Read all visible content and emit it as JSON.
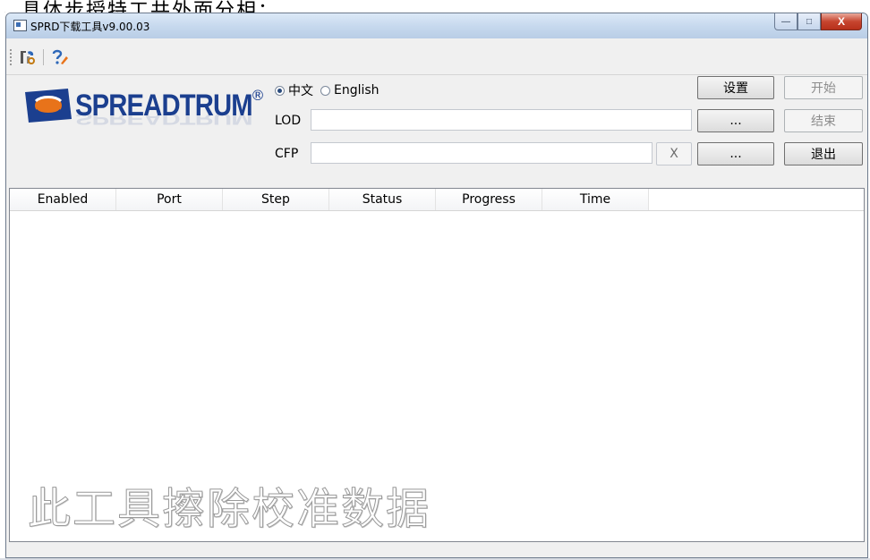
{
  "page_caption": "，具体步授特工共外面分相：",
  "window": {
    "title": "SPRD下载工具v9.00.03",
    "controls": {
      "minimize": "—",
      "maximize": "□",
      "close": "X"
    }
  },
  "toolbar": {
    "icons": [
      "settings-tools-icon",
      "help-icon"
    ]
  },
  "logo": {
    "brand": "SPREADTRUM",
    "registered": "®"
  },
  "language": {
    "selected": "中文",
    "options": [
      "中文",
      "English"
    ]
  },
  "fields": {
    "lod": {
      "label": "LOD",
      "value": ""
    },
    "cfp": {
      "label": "CFP",
      "value": ""
    }
  },
  "buttons": {
    "settings": "设置",
    "start": "开始",
    "stop": "结束",
    "exit": "退出",
    "browse_lod": "...",
    "browse_cfp": "...",
    "clear_cfp": "X"
  },
  "button_state": {
    "start_enabled": false,
    "stop_enabled": false
  },
  "table": {
    "columns": [
      "Enabled",
      "Port",
      "Step",
      "Status",
      "Progress",
      "Time"
    ],
    "rows": []
  },
  "watermark": "此工具擦除校准数据",
  "colors": {
    "brand_blue": "#1b3f8f",
    "brand_orange": "#e8731a",
    "close_red": "#c7452f",
    "titlebar": "#c7d9ee"
  }
}
